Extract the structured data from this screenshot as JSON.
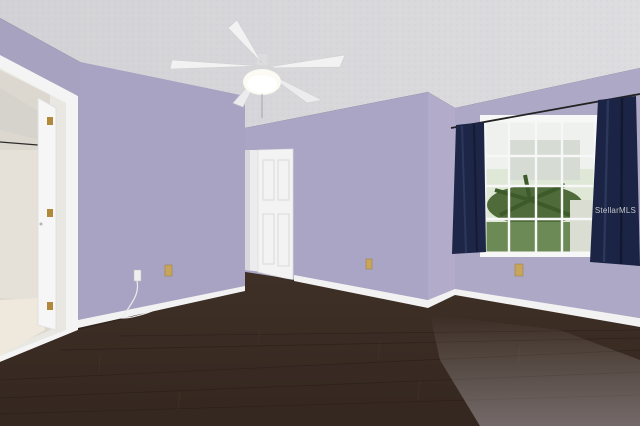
{
  "scene": {
    "type": "empty bedroom interior photo",
    "elements": [
      "textured-ceiling",
      "ceiling-fan",
      "lavender-walls",
      "open-white-door",
      "bathroom-doorway",
      "window-with-palm-view",
      "navy-curtains",
      "dark-hardwood-floor",
      "white-baseboards",
      "electrical-outlets"
    ]
  },
  "watermark": {
    "text": "StellarMLS"
  },
  "colors": {
    "wall": "#aaa3c4",
    "ceiling": "#d9d9dc",
    "floor": "#3b2d24",
    "trim": "#f2f2f2",
    "curtain": "#1c2545"
  }
}
